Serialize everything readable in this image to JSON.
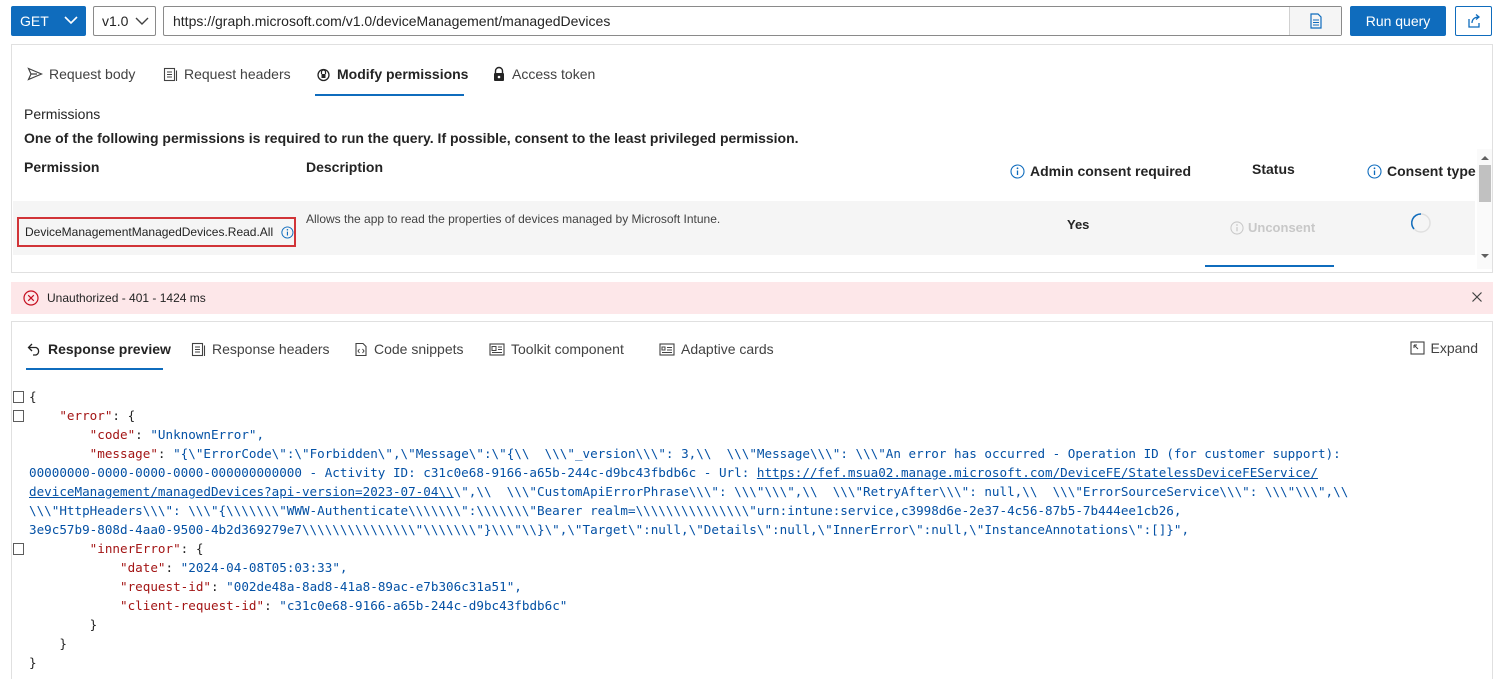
{
  "query": {
    "method": "GET",
    "version": "v1.0",
    "url": "https://graph.microsoft.com/v1.0/deviceManagement/managedDevices",
    "run_label": "Run query"
  },
  "request_tabs": [
    {
      "label": "Request body",
      "icon": "send-icon"
    },
    {
      "label": "Request headers",
      "icon": "headers-icon"
    },
    {
      "label": "Modify permissions",
      "icon": "shield-lock-icon",
      "active": true
    },
    {
      "label": "Access token",
      "icon": "lock-icon"
    }
  ],
  "permissions": {
    "title": "Permissions",
    "description": "One of the following permissions is required to run the query. If possible, consent to the least privileged permission.",
    "columns": {
      "permission": "Permission",
      "description": "Description",
      "admin": "Admin consent required",
      "status": "Status",
      "consent_type": "Consent type"
    },
    "rows": [
      {
        "name": "DeviceManagementManagedDevices.Read.All",
        "description": "Allows the app to read the properties of devices managed by Microsoft Intune.",
        "admin_required": "Yes",
        "status_action": "Unconsent"
      }
    ]
  },
  "error": {
    "message": "Unauthorized - 401 - 1424 ms",
    "color": "#fde7e9"
  },
  "response_tabs": [
    {
      "label": "Response preview",
      "icon": "preview-icon",
      "active": true
    },
    {
      "label": "Response headers",
      "icon": "headers-icon"
    },
    {
      "label": "Code snippets",
      "icon": "code-icon"
    },
    {
      "label": "Toolkit component",
      "icon": "toolkit-icon"
    },
    {
      "label": "Adaptive cards",
      "icon": "card-icon"
    }
  ],
  "expand_label": "Expand",
  "response_lines": [
    "{",
    "    \"error\": {",
    "        \"code\": \"UnknownError\",",
    "        \"message\": \"{\\\"ErrorCode\\\":\\\"Forbidden\\\",\\\"Message\\\":\\\"{\\\\  \\\\\\\"_version\\\\\\\": 3,\\\\  \\\\\\\"Message\\\\\\\": \\\\\\\"An error has occurred - Operation ID (for customer support):",
    "00000000-0000-0000-0000-000000000000 - Activity ID: c31c0e68-9166-a65b-244c-d9bc43fbdb6c - Url: https://fef.msua02.manage.microsoft.com/DeviceFE/StatelessDeviceFEService/",
    "deviceManagement/managedDevices?api-version=2023-07-04\\\\\\\",\\\\  \\\\\\\"CustomApiErrorPhrase\\\\\\\": \\\\\\\"\\\\\\\",\\\\  \\\\\\\"RetryAfter\\\\\\\": null,\\\\  \\\\\\\"ErrorSourceService\\\\\\\": \\\\\\\"\\\\\\\",\\\\",
    "\\\\\\\"HttpHeaders\\\\\\\": \\\\\\\"{\\\\\\\\\\\\\\\"WWW-Authenticate\\\\\\\\\\\\\\\":\\\\\\\\\\\\\\\"Bearer realm=\\\\\\\\\\\\\\\\\\\\\\\\\\\\\\\"urn:intune:service,c3998d6e-2e37-4c56-87b5-7b444ee1cb26,",
    "3e9c57b9-808d-4aa0-9500-4b2d369279e7\\\\\\\\\\\\\\\\\\\\\\\\\\\\\\\"\\\\\\\\\\\\\\\"}\\\\\\\"\\\\}\\\",\\\"Target\\\":null,\\\"Details\\\":null,\\\"InnerError\\\":null,\\\"InstanceAnnotations\\\":[]}\",",
    "        \"innerError\": {",
    "            \"date\": \"2024-04-08T05:03:33\",",
    "            \"request-id\": \"002de48a-8ad8-41a8-89ac-e7b306c31a51\",",
    "            \"client-request-id\": \"c31c0e68-9166-a65b-244c-d9bc43fbdb6c\"",
    "        }",
    "    }",
    "}"
  ],
  "colors": {
    "accent": "#0f6cbd",
    "error_outline": "#d13438",
    "json_key": "#a31515",
    "json_string": "#0451a5"
  }
}
